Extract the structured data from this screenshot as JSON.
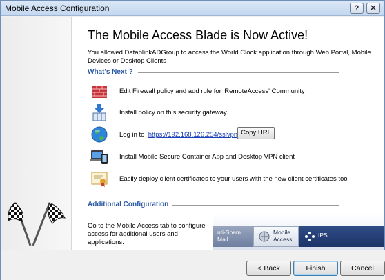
{
  "window": {
    "title": "Mobile Access Configuration",
    "help_label": "?",
    "close_label": "✕"
  },
  "main": {
    "heading": "The Mobile Access Blade is Now Active!",
    "intro": "You allowed DatablinkADGroup to access the World Clock application through Web Portal, Mobile Devices or Desktop Clients",
    "whats_next_title": "What's Next ?",
    "steps": [
      {
        "icon": "firewall-icon",
        "text": "Edit Firewall policy and add rule for 'RemoteAccess' Community"
      },
      {
        "icon": "install-policy-icon",
        "text": "Install policy on this security gateway"
      },
      {
        "icon": "globe-icon",
        "prefix": "Log in to",
        "link": "https://192.168.126.254/sslvpn",
        "button": "Copy URL"
      },
      {
        "icon": "devices-icon",
        "text": "Install Mobile Secure Container App and Desktop VPN client"
      },
      {
        "icon": "certificate-icon",
        "text": "Easily deploy client certificates to your users with the new client certificates tool"
      }
    ],
    "additional_title": "Additional Configuration",
    "additional_text": "Go to the Mobile Access tab to configure access for additional users and applications.",
    "tabs": {
      "antispam_line1": "nti-Spam",
      "antispam_line2": "Mail",
      "mobile_line1": "Mobile",
      "mobile_line2": "Access",
      "ips": "IPS"
    }
  },
  "footer": {
    "back": "< Back",
    "finish": "Finish",
    "cancel": "Cancel"
  }
}
